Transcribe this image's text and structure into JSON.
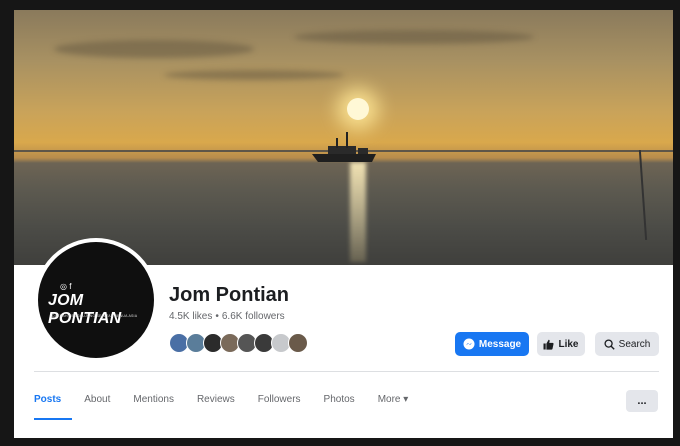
{
  "page": {
    "name": "Jom Pontian",
    "likes": "4.5K likes",
    "separator": "•",
    "followers": "6.6K followers"
  },
  "avatar": {
    "brand": "JOM PONTIAN",
    "social": "◎ f",
    "tagline": "DAERAH PENGHUJUNG SELATAN BENUA ASIA"
  },
  "follower_avatars": [
    "#4a6fa5",
    "#5a7d9a",
    "#2b2b2b",
    "#7a6a5a",
    "#555555",
    "#3a3a3a",
    "#c7c9cc",
    "#6a5a4a"
  ],
  "actions": {
    "message": "Message",
    "like": "Like",
    "search": "Search",
    "more": "..."
  },
  "tabs": [
    "Posts",
    "About",
    "Mentions",
    "Reviews",
    "Followers",
    "Photos",
    "More ▾"
  ],
  "colors": {
    "accent": "#1877f2",
    "button_grey": "#e4e6eb"
  }
}
